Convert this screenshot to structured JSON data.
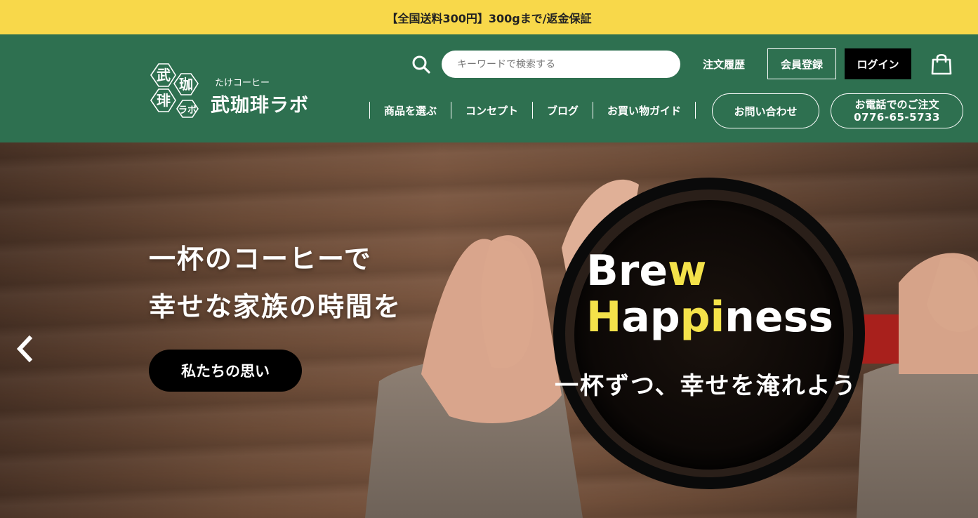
{
  "announcement": "【全国送料300円】300gまで/返金保証",
  "logo": {
    "sub": "たけコーヒー",
    "name": "武珈琲ラボ",
    "mark_chars": [
      "武",
      "珈",
      "琲",
      "ラボ"
    ]
  },
  "search": {
    "placeholder": "キーワードで検索する",
    "value": ""
  },
  "account": {
    "order_history": "注文履歴",
    "register": "会員登録",
    "login": "ログイン"
  },
  "nav": [
    "商品を選ぶ",
    "コンセプト",
    "ブログ",
    "お買い物ガイド"
  ],
  "contact": {
    "inquiry": "お問い合わせ",
    "phone_label": "お電話でのご注文",
    "phone_number": "0776-65-5733"
  },
  "hero": {
    "headline_1": "一杯のコーヒーで",
    "headline_2": "幸せな家族の時間を",
    "cta": "私たちの思い",
    "brew_line1": {
      "a": "Bre",
      "b": "w"
    },
    "brew_line2": {
      "a": "H",
      "b": "ap",
      "c": "pi",
      "d": "ness"
    },
    "tagline": "一杯ずつ、幸せを淹れよう"
  },
  "colors": {
    "announce_bg": "#f8d84a",
    "header_bg": "#2e7050",
    "accent_yellow": "#f4e24a",
    "black": "#000000"
  },
  "icons": [
    "search-icon",
    "cart-icon",
    "chevron-left-icon"
  ]
}
